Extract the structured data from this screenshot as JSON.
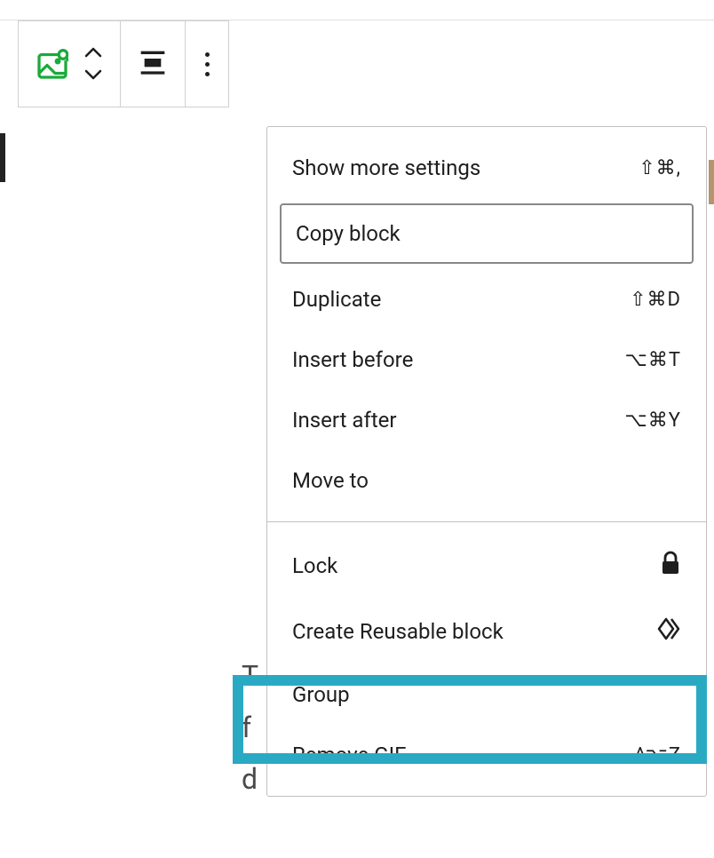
{
  "toolbar": {
    "block_type": "gif-image-block"
  },
  "menu": {
    "groups": [
      {
        "items": [
          {
            "key": "show_more",
            "label": "Show more settings",
            "shortcut": "⇧⌘,"
          },
          {
            "key": "copy_block",
            "label": "Copy block",
            "shortcut": "",
            "boxed": true
          },
          {
            "key": "duplicate",
            "label": "Duplicate",
            "shortcut": "⇧⌘D"
          },
          {
            "key": "insert_before",
            "label": "Insert before",
            "shortcut": "⌥⌘T"
          },
          {
            "key": "insert_after",
            "label": "Insert after",
            "shortcut": "⌥⌘Y"
          },
          {
            "key": "move_to",
            "label": "Move to",
            "shortcut": ""
          }
        ]
      },
      {
        "items": [
          {
            "key": "lock",
            "label": "Lock",
            "icon": "lock"
          },
          {
            "key": "create_reusable",
            "label": "Create Reusable block",
            "icon": "diamond"
          },
          {
            "key": "group",
            "label": "Group",
            "highlighted": true
          },
          {
            "key": "remove_gif",
            "label": "Remove GIF",
            "shortcut": "^⌥Z"
          }
        ]
      }
    ]
  },
  "bg_text": {
    "t1": "T",
    "t2": "f",
    "t3": "d"
  }
}
